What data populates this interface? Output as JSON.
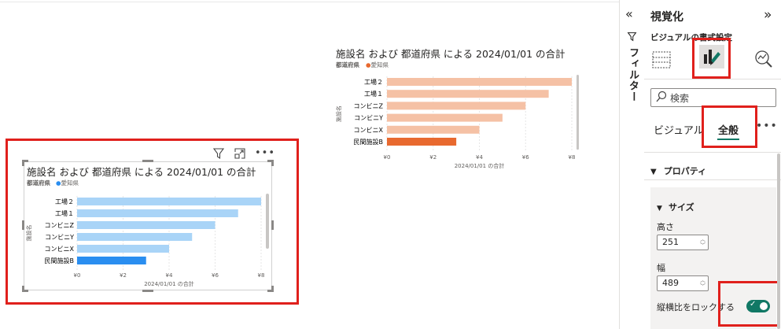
{
  "charts": {
    "top": {
      "title": "施設名 および 都道府県 による 2024/01/01 の合計",
      "legend_label": "都道府県",
      "legend_item": "愛知県",
      "y_title": "施設名",
      "x_title": "2024/01/01 の合計"
    },
    "bottom": {
      "title": "施設名 および 都道府県 による 2024/01/01 の合計",
      "legend_label": "都道府県",
      "legend_item": "愛知県",
      "y_title": "施設名",
      "x_title": "2024/01/01 の合計"
    }
  },
  "chart_data": [
    {
      "type": "bar",
      "orientation": "horizontal",
      "title": "施設名 および 都道府県 による 2024/01/01 の合計",
      "xlabel": "2024/01/01 の合計",
      "ylabel": "施設名",
      "legend_title": "都道府県",
      "categories": [
        "工場２",
        "工場１",
        "コンビニZ",
        "コンビニY",
        "コンビニX",
        "民間施設B"
      ],
      "values": [
        8,
        7,
        6,
        5,
        4,
        3
      ],
      "highlighted": [
        "民間施設B"
      ],
      "xlim": [
        0,
        8
      ],
      "xticks": [
        "¥0",
        "¥2",
        "¥4",
        "¥6",
        "¥8"
      ],
      "series": [
        {
          "name": "愛知県",
          "values": [
            8,
            7,
            6,
            5,
            4,
            3
          ]
        }
      ],
      "colors": {
        "bar": "#f5c1a5",
        "highlight": "#e8692f"
      }
    },
    {
      "type": "bar",
      "orientation": "horizontal",
      "title": "施設名 および 都道府県 による 2024/01/01 の合計",
      "xlabel": "2024/01/01 の合計",
      "ylabel": "施設名",
      "legend_title": "都道府県",
      "categories": [
        "工場２",
        "工場１",
        "コンビニZ",
        "コンビニY",
        "コンビニX",
        "民間施設B"
      ],
      "values": [
        8,
        7,
        6,
        5,
        4,
        3
      ],
      "highlighted": [
        "民間施設B"
      ],
      "xlim": [
        0,
        8
      ],
      "xticks": [
        "¥0",
        "¥2",
        "¥4",
        "¥6",
        "¥8"
      ],
      "series": [
        {
          "name": "愛知県",
          "values": [
            8,
            7,
            6,
            5,
            4,
            3
          ]
        }
      ],
      "colors": {
        "bar": "#a9d4f7",
        "highlight": "#2a8ef0"
      }
    }
  ],
  "filters": {
    "label": "フィルター"
  },
  "viz": {
    "title": "視覚化",
    "subtitle": "ビジュアルの書式設定",
    "search_placeholder": "検索",
    "tabs": {
      "visual": "ビジュアル",
      "general": "全般"
    },
    "properties": "プロパティ",
    "size": "サイズ",
    "height_label": "高さ",
    "height_value": "251",
    "width_label": "幅",
    "width_value": "489",
    "lock_aspect": "縦横比をロックする",
    "lock_on": true
  },
  "colors": {
    "accent": "#117865",
    "highlight_box": "#e0201c"
  }
}
